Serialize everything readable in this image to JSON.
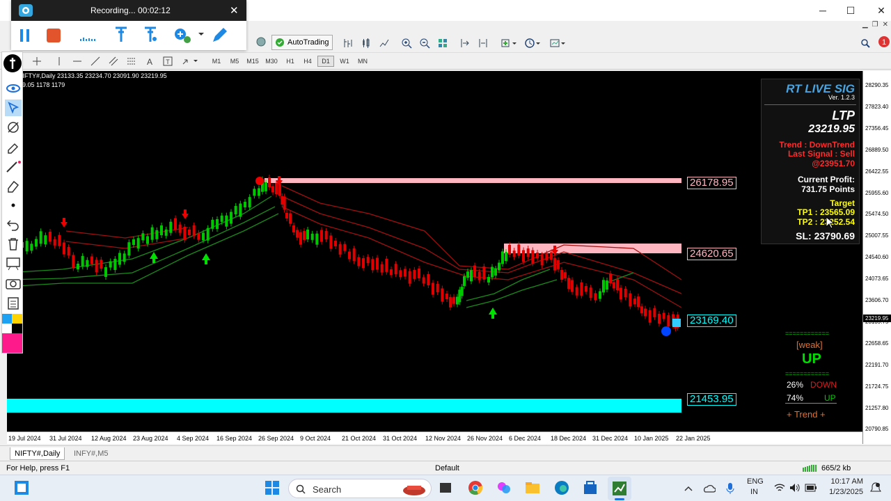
{
  "recorder": {
    "status": "Recording... 00:02:12",
    "close": "✕"
  },
  "window": {
    "minimize": "─",
    "maximize": "☐",
    "close": "✕"
  },
  "toolbar": {
    "autotrading_label": "AutoTrading",
    "timeframes": [
      "M1",
      "M5",
      "M15",
      "M30",
      "H1",
      "H4",
      "D1",
      "W1",
      "MN"
    ],
    "active_timeframe": "D1"
  },
  "chart": {
    "info_line": "NIFTY#,Daily  23133.35 23234.70 23091.90 23219.95",
    "info_line2": "9.05  1178  1179",
    "levels": [
      "26178.95",
      "24620.65",
      "23169.40",
      "21453.95"
    ],
    "y_labels": [
      "28290.35",
      "27823.40",
      "27356.45",
      "26889.50",
      "26422.55",
      "25955.60",
      "25474.50",
      "25007.55",
      "24540.60",
      "24073.65",
      "23606.70",
      "23139.75",
      "22658.65",
      "22191.70",
      "21724.75",
      "21257.80",
      "20790.85"
    ],
    "y_current": "23219.95",
    "x_labels": [
      "19 Jul 2024",
      "31 Jul 2024",
      "12 Aug 2024",
      "23 Aug 2024",
      "4 Sep 2024",
      "16 Sep 2024",
      "26 Sep 2024",
      "9 Oct 2024",
      "21 Oct 2024",
      "31 Oct 2024",
      "12 Nov 2024",
      "26 Nov 2024",
      "6 Dec 2024",
      "18 Dec 2024",
      "31 Dec 2024",
      "10 Jan 2025",
      "22 Jan 2025"
    ]
  },
  "signal_panel": {
    "title": "RT LIVE SIG",
    "version": "Ver. 1.2.3",
    "ltp_label": "LTP",
    "ltp_value": "23219.95",
    "trend": "Trend : DownTrend",
    "last_signal": "Last Signal : Sell",
    "signal_price": "@23951.70",
    "profit_label": "Current Profit:",
    "profit_value": "731.75 Points",
    "target_label": "Target",
    "tp1": "TP1 : 23565.09",
    "tp2": "TP2 : 23252.54",
    "sl": "SL: 23790.69"
  },
  "strength_panel": {
    "dashes": "============",
    "weak": "[weak]",
    "direction": "UP",
    "down_pct": "26%",
    "down_label": "DOWN",
    "up_pct": "74%",
    "up_label": "UP",
    "trend_line": "+  Trend  +"
  },
  "tabs": [
    "NIFTY#,Daily",
    "INFY#,M5"
  ],
  "status": {
    "help": "For Help, press F1",
    "profile": "Default",
    "traffic": "665/2 kb"
  },
  "taskbar": {
    "search": "Search",
    "lang1": "ENG",
    "lang2": "IN",
    "time": "10:17 AM",
    "date": "1/23/2025"
  },
  "colors": {
    "bull": "#00c800",
    "bear": "#e00000",
    "cyan_zone": "#00ffff",
    "pink_zone": "#ffb6c1",
    "panel_title": "#4aa3df",
    "panel_red": "#ff2a2a",
    "panel_yellow": "#ffff00"
  }
}
